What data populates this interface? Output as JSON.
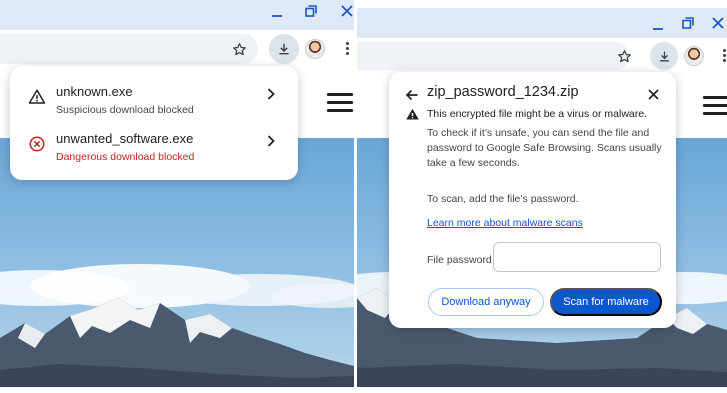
{
  "colors": {
    "titlebar": "#dfe8f7",
    "accent": "#0b57d0",
    "danger": "#c5221f",
    "window_controls": "#1a56c8"
  },
  "left": {
    "download_items": [
      {
        "filename": "unknown.exe",
        "status": "Suspicious download blocked",
        "icon": "warning-triangle-icon",
        "severity": "suspicious"
      },
      {
        "filename": "unwanted_software.exe",
        "status": "Dangerous download blocked",
        "icon": "dangerous-x-circle-icon",
        "severity": "dangerous"
      }
    ]
  },
  "right": {
    "dialog": {
      "title": "zip_password_1234.zip",
      "warning": "This encrypted file might be a virus or malware.",
      "paragraph_lines": [
        "To check if it’s unsafe, you can send the file and",
        "password to Google Safe Browsing. Scans usually",
        "take a few seconds."
      ],
      "scan_hint": "To scan, add the file’s password.",
      "learn_more": "Learn more about malware scans",
      "password_label": "File password",
      "password_value": "",
      "password_placeholder": "",
      "download_anyway": "Download anyway",
      "scan_button": "Scan for malware"
    }
  }
}
